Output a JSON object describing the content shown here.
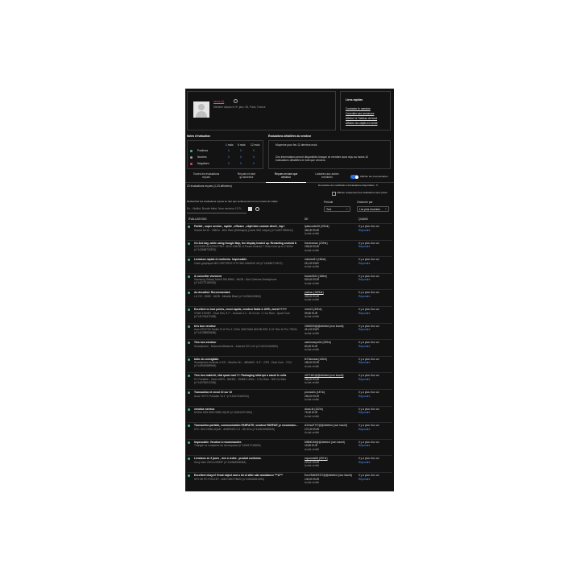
{
  "profile": {
    "username": "xxxxx (4)",
    "member_text": "Membre depuis le 9+ janv. 06, Paris, France"
  },
  "links_box": {
    "title": "Liens rapides",
    "links": [
      "Contacter le membre",
      "Consulter ses annonces",
      "Afficher le Tableau de bord",
      "Afficher les objets en vente"
    ]
  },
  "notes": {
    "title": "Notes d'évaluation",
    "columns": [
      "1 mois",
      "6 mois",
      "12 mois"
    ],
    "rows": [
      {
        "label": "Positives",
        "v1": "0",
        "v2": "0",
        "v3": "0",
        "color": "#3fbf6f"
      },
      {
        "label": "Neutres",
        "v1": "0",
        "v2": "0",
        "v3": "0",
        "color": "#9a9a9a"
      },
      {
        "label": "Négatives",
        "v1": "0",
        "v2": "0",
        "v3": "0",
        "color": "#e0445a"
      }
    ]
  },
  "detailed": {
    "title": "Évaluations détaillées du vendeur",
    "subtitle": "Moyenne pour les 12 derniers mois",
    "text1": "Ces informations seront disponibles lorsque ce membre aura reçu au moins 10",
    "text2": "évaluations détaillées en tant que vendeur."
  },
  "tabs": [
    {
      "line1": "Toutes les évaluations",
      "line2": "reçues",
      "active": false
    },
    {
      "line1": "Reçues en tant",
      "line2": "qu'acheteur",
      "active": false
    },
    {
      "line1": "Reçues en tant que",
      "line2": "vendeur",
      "active": true
    },
    {
      "line1": "Laissées aux autres",
      "line2": "membres",
      "active": false
    }
  ],
  "toggle_label": "Afficher les commentaires",
  "count_text": "23 évaluations reçues (1-23 affichées)",
  "revisions_text": "Demandes de modification d'évaluations disponibles : 5",
  "checkbox_label": "Afficher uniquement les évaluations avec photo",
  "search": {
    "label": "Rechercher les évaluations reçues en tant que vendeur par mot ou numéro de l'objet",
    "placeholder": "Ex. : Maillot, Boucle bébé, Nom vendeur 12 R...",
    "periode_label": "Période",
    "periode_value": "Tout",
    "ordre_label": "Ordonner par",
    "ordre_value": "Les plus récentes"
  },
  "table_headers": {
    "evals": "ÉVALUATIONS",
    "de": "DE",
    "quand": "QUAND"
  },
  "rows": [
    {
      "title": "Parfait , super service , rapide , efficace , objet bien comme décrit , top !",
      "sub": "Xiaomi Mi 10 - 256Go - 8Go Ram (Débloqué) (Carte SIM unique) (n°144677889411)",
      "user": "lpatocoder06 (230★)",
      "price": "462,50 EUR",
      "verif": "Achat vérifié",
      "when": "Il y a plus d'un an",
      "reply": "Répondre"
    },
    {
      "title": "On 2nd day, while using Google Map, the display heated up. Restarting android 6.",
      "sub": "DOOGEE BL12000 PRO - 6Go+128GB, 6 Pouce Android 7 Octa Core up to 2.5GHz (n°142668729876)",
      "user": "thenewman (239★)",
      "price": "195,00 EUR",
      "verif": "Achat vérifié",
      "when": "Il y a plus d'un an",
      "reply": "Répondre"
    },
    {
      "title": "Livraison rapide et conforme. Impeccable.",
      "sub": "Carte graphique MSI GEFORCE GTX 960 GAMING 4G (n°142884774672)",
      "user": "mlonico51 (166★)",
      "price": "211,00 EUR",
      "verif": "Achat vérifié",
      "when": "Il y a plus d'un an",
      "reply": "Répondre"
    },
    {
      "title": "À conseiller vivement",
      "sub": "Samsung Galaxy Note9 SM-N960 - 64GB - Noir Carbone Smartphone (n°142737189316)",
      "user": "franck3012 (188★)",
      "price": "520,00 EUR",
      "verif": "Achat vérifié",
      "when": "Il y a plus d'un an",
      "reply": "Répondre"
    },
    {
      "title": "Au decathol. Recommended.",
      "sub": "LG G3 - D855 - 16GB - Metallic Black (n°141963449481)",
      "user": "patmar (1825★)",
      "price": "200,00 EUR",
      "verif": "Achat vérifié",
      "when": "Il y a plus d'un an",
      "reply": "Répondre"
    },
    {
      "title": "Excellent en tout points, envoi rapide, vendeur fiable à 100%, merci+++++",
      "sub": "STAR Z700BT - Dual Sim, 5.7\" - Android 4.2 - 16 Go Int. / 1 Go Ram - Quad Core (n°141706472308)",
      "user": "nmn13 (326★)",
      "price": "99,50 EUR",
      "verif": "Achat vérifié",
      "when": "Il y a plus d'un an",
      "reply": "Répondre"
    },
    {
      "title": "très bon vendeur",
      "sub": "Acer AT04700 Tactile i3 10 Pro 1.7GHz 4GB RAM 240GB SSD 11.6\" Win 10 Pro 750Go (n°141398855636)",
      "user": "2063000@@deleted (non inscrit)",
      "price": "411,00 EUR",
      "verif": "Achat vérifié",
      "when": "Il y a plus d'un an",
      "reply": "Répondre"
    },
    {
      "title": "Très bon vendeur",
      "sub": "Smartphone - Motorola Milestone - Android OS 4.04 (n°141023462682)",
      "user": "carlomaxym04 (239★)",
      "price": "60,00 EUR",
      "verif": "Achat vérifié",
      "when": "Il y a plus d'un an",
      "reply": "Répondre"
    },
    {
      "title": "tutto ok.consigliato",
      "sub": "Smartphone Android 4 ICS - Neuther N1 - 480x800 - 5.3\" - GPS - Dual Core - YOU (n°140919585945)",
      "user": "tlr70amada (145★)",
      "price": "180,00 EUR",
      "verif": "Achat vérifié",
      "when": "Il y a plus d'un an",
      "reply": "Répondre"
    },
    {
      "title": "Très bon matériel, état quasi neuf !! ! Packaging idéal qui a sauvé le colis",
      "sub": "PC Portable - Clevo M570 - 8M/M2 - 15368 2.4Ghz - 2 Go Ram - 500 Go Bleu (n°140750012336)",
      "user": "4077461@@deleted (non inscrit)",
      "price": "200,00 EUR",
      "verif": "Achat vérifié",
      "when": "Il y a plus d'un an",
      "reply": "Répondre"
    },
    {
      "title": "Transaction et envoi 10 sur 10",
      "sub": "Asus H9 PC Portable 15.1\" (n°140675449234)",
      "user": "promobin (187★)",
      "price": "250,00 EUR",
      "verif": "Achat vérifié",
      "when": "Il y a plus d'un an",
      "reply": "Répondre"
    },
    {
      "title": "vendeur serieux",
      "sub": "NOKIA N95 8GB DEBLOQUE (n°140613071352)",
      "user": "stock-lb (102★)",
      "price": "75,00 EUR",
      "verif": "Achat vérifié",
      "when": "Il y a plus d'un an",
      "reply": "Répondre"
    },
    {
      "title": "Transaction parfaite, communication PARFAITE, vendeur PARFAIT, je recommande !!!",
      "sub": "HTC HD2 DEBLOQUE - ANDROID 2.3 - SD 4Go (n°140615082525)",
      "user": "AXXsulTHT@@deleted (non inscrit)",
      "price": "171,00 EUR",
      "verif": "Achat vérifié",
      "when": "Il y a plus d'un an",
      "reply": "Répondre"
    },
    {
      "title": "Impeccable. Vendeur à recommander.",
      "sub": "Triangle Le complexe du chrompanot (n°140617018826)",
      "user": "Mf6MD45@@deleted (non inscrit)",
      "price": "15,50 EUR",
      "verif": "Achat vérifié",
      "when": "Il y a plus d'un an",
      "reply": "Répondre"
    },
    {
      "title": "Livraison en 2 jours , rien a redire , produit conforme.",
      "sub": "Sony Vaio VGN-UX390P (n°140548938464)",
      "user": "exponnts06 (287★)",
      "price": "223,01 EUR",
      "verif": "Achat vérifié",
      "when": "Il y a plus d'un an",
      "reply": "Répondre"
    },
    {
      "title": "Excellent ebayer! Great object and a lot of after sale assistance ***A***",
      "sub": "SFX MI PC POCKET - AIKO MID P8000 (n°140618510290)",
      "user": "EnzVM4hEEGT@@deleted (non inscrit)",
      "price": "130,00 EUR",
      "verif": "Achat vérifié",
      "when": "Il y a plus d'un an",
      "reply": "Répondre"
    }
  ],
  "colors": {
    "background": "#131314",
    "accent": "#4a9cff",
    "positive": "#3fbf6f",
    "negative": "#e0445a"
  },
  "icons": [
    "user-avatar-icon",
    "info-icon",
    "search-icon",
    "chevron-down-icon",
    "positive-dot-icon"
  ]
}
